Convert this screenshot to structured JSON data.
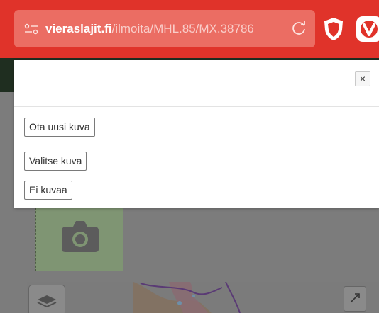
{
  "browser": {
    "url_domain": "vieraslajit.fi",
    "url_path": "/ilmoita/MHL.85/MX.38786",
    "icons": [
      "site-settings-icon",
      "reload-icon",
      "shield-icon",
      "vivaldi-icon"
    ]
  },
  "modal": {
    "close_label": "×",
    "options": {
      "take_photo": "Ota uusi kuva",
      "choose_photo": "Valitse kuva",
      "no_photo": "Ei kuvaa"
    }
  },
  "map": {
    "icons": [
      "layers-icon",
      "expand-icon"
    ]
  },
  "colors": {
    "browser_bar": "#e0332a",
    "url_box": "#eb6d63",
    "overlay_bg": "#7c7c7c"
  }
}
